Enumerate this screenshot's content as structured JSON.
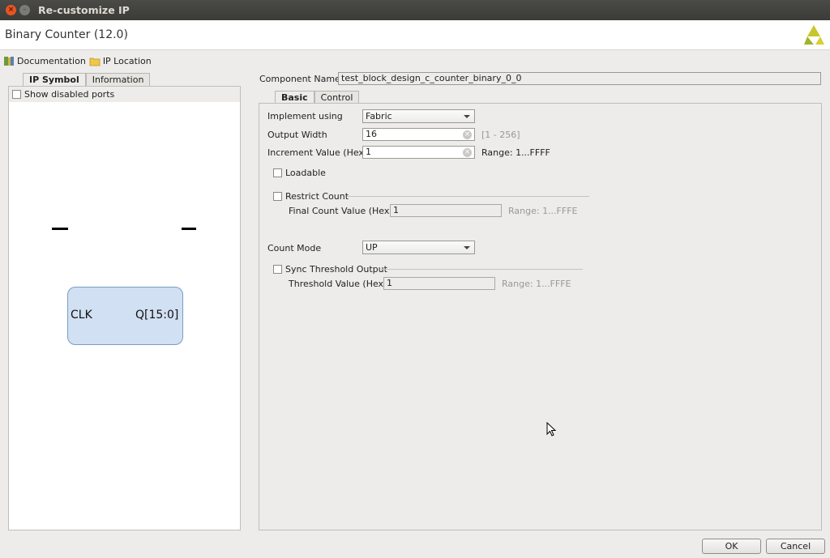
{
  "window": {
    "title": "Re-customize IP"
  },
  "header": {
    "title": "Binary Counter (12.0)",
    "logo_icon": "xilinx-logo-icon"
  },
  "links": [
    {
      "label": "Documentation",
      "icon": "book-icon"
    },
    {
      "label": "IP Location",
      "icon": "folder-icon"
    }
  ],
  "left_panel": {
    "tabs": [
      "IP Symbol",
      "Information"
    ],
    "active_tab": "IP Symbol",
    "show_disabled_ports": "Show disabled ports",
    "symbol": {
      "input_port": "CLK",
      "output_port": "Q[15:0]"
    }
  },
  "component": {
    "label": "Component Name",
    "value": "test_block_design_c_counter_binary_0_0"
  },
  "right_panel": {
    "tabs": [
      "Basic",
      "Control"
    ],
    "active_tab": "Basic",
    "implement_using": {
      "label": "Implement using",
      "value": "Fabric"
    },
    "output_width": {
      "label": "Output Width",
      "value": "16",
      "hint": "[1 - 256]"
    },
    "increment_value": {
      "label": "Increment Value (Hex)",
      "value": "1",
      "hint": "Range: 1...FFFF"
    },
    "loadable": {
      "label": "Loadable",
      "checked": false
    },
    "restrict_count": {
      "label": "Restrict Count",
      "checked": false
    },
    "final_count": {
      "label": "Final Count Value (Hex)",
      "value": "1",
      "hint": "Range: 1...FFFE"
    },
    "count_mode": {
      "label": "Count Mode",
      "value": "UP"
    },
    "sync_threshold": {
      "label": "Sync Threshold Output",
      "checked": false
    },
    "threshold_value": {
      "label": "Threshold Value (Hex)",
      "value": "1",
      "hint": "Range: 1...FFFE"
    }
  },
  "footer": {
    "ok": "OK",
    "cancel": "Cancel"
  },
  "colors": {
    "titlebar": "#3b3b38",
    "close": "#e95420",
    "symbol_fill": "#d1e0f2",
    "symbol_border": "#7a9cc7"
  }
}
